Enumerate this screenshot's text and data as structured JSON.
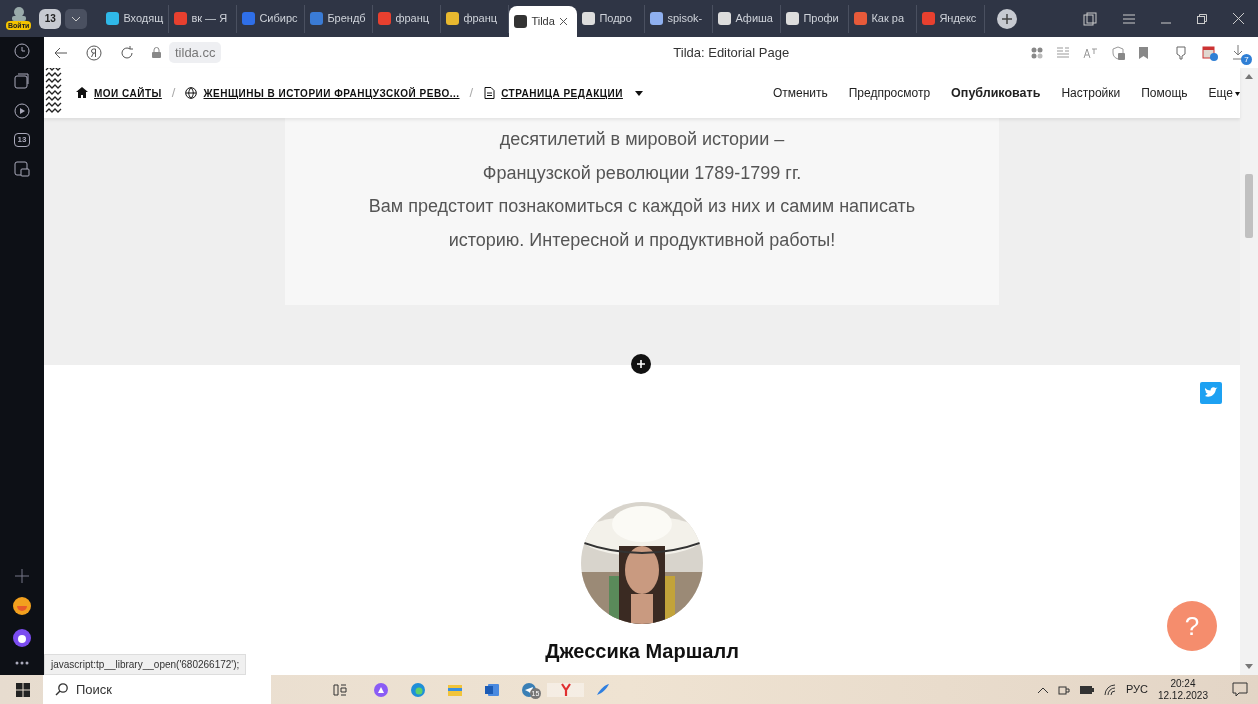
{
  "browser": {
    "profile_button": "Войти",
    "tab_count": "13",
    "tabs": [
      {
        "label": "Входящ",
        "selected": false,
        "color": "#2fb8e8"
      },
      {
        "label": "вк — Я",
        "selected": false,
        "color": "#e8402f"
      },
      {
        "label": "Сибирс",
        "selected": false,
        "color": "#2f6fe8"
      },
      {
        "label": "Брендб",
        "selected": false,
        "color": "#3a7bd5"
      },
      {
        "label": "франц",
        "selected": false,
        "color": "#e8402f"
      },
      {
        "label": "франц",
        "selected": false,
        "color": "#e8b82f"
      },
      {
        "label": "Tilda",
        "selected": true,
        "color": "#333333"
      },
      {
        "label": "Подро",
        "selected": false,
        "color": "#dddddd"
      },
      {
        "label": "spisok-",
        "selected": false,
        "color": "#8fb0f0"
      },
      {
        "label": "Афиша",
        "selected": false,
        "color": "#dddddd"
      },
      {
        "label": "Профи",
        "selected": false,
        "color": "#dddddd"
      },
      {
        "label": "Как ра",
        "selected": false,
        "color": "#e85a3a"
      },
      {
        "label": "Яндекс",
        "selected": false,
        "color": "#e8402f"
      }
    ],
    "address": "tilda.cc",
    "page_title": "Tilda: Editorial Page",
    "download_count": "7",
    "sidebar_badge": "13"
  },
  "tilda_toolbar": {
    "breadcrumbs": [
      {
        "kind": "home",
        "label": "МОИ САЙТЫ"
      },
      {
        "kind": "site",
        "label": "ЖЕНЩИНЫ В ИСТОРИИ ФРАНЦУЗСКОЙ РЕВО..."
      },
      {
        "kind": "page",
        "label": "СТРАНИЦА РЕДАКЦИИ"
      }
    ],
    "separator": "/",
    "actions": [
      {
        "label": "Отменить",
        "primary": false
      },
      {
        "label": "Предпросмотр",
        "primary": false
      },
      {
        "label": "Опубликовать",
        "primary": true
      },
      {
        "label": "Настройки",
        "primary": false
      },
      {
        "label": "Помощь",
        "primary": false
      },
      {
        "label": "Еще",
        "primary": false
      }
    ]
  },
  "intro": {
    "lines": [
      {
        "text": "десятилетий в мировой истории –"
      },
      {
        "text": "Французской революции 1789-1799 гг."
      },
      {
        "text": "Вам предстоит познакомиться с каждой из них и самим написать"
      },
      {
        "text": "историю. Интересной и продуктивной работы!"
      }
    ]
  },
  "profile": {
    "name": "Джессика Маршалл"
  },
  "help_button": "?",
  "status_link": "javascript:tp__library__open('680266172');",
  "taskbar": {
    "search_placeholder": "Поиск",
    "telegram_badge": "15",
    "language": "РУС",
    "time": "20:24",
    "date": "12.12.2023"
  }
}
